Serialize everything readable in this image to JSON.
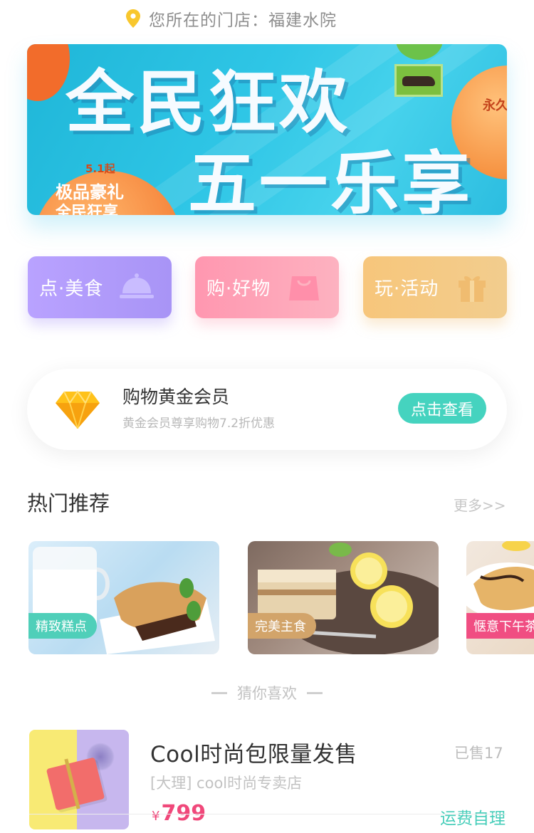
{
  "store": {
    "label": "您所在的门店：福建水院",
    "pin_icon": "location-pin-icon",
    "pin_color": "#f8c72d"
  },
  "banner": {
    "headline_line1": "全民狂欢",
    "headline_line2": "五一乐享",
    "date_tag": "5.1起",
    "gift_line1": "极品豪礼",
    "gift_line2": "全民狂享",
    "side_text": "永久"
  },
  "categories": [
    {
      "label": "点·美食",
      "icon": "food-cloche-icon",
      "color": "#b19cfb"
    },
    {
      "label": "购·好物",
      "icon": "shopping-bag-icon",
      "color": "#fda3b8"
    },
    {
      "label": "玩·活动",
      "icon": "gift-box-icon",
      "color": "#f4c985"
    }
  ],
  "member": {
    "title": "购物黄金会员",
    "desc": "黄金会员尊享购物7.2折优惠",
    "button": "点击查看",
    "icon": "diamond-icon",
    "button_color": "#45d3bf"
  },
  "hot": {
    "title": "热门推荐",
    "more": "更多>>",
    "items": [
      {
        "tag": "精致糕点"
      },
      {
        "tag": "完美主食"
      },
      {
        "tag": "惬意下午茶"
      }
    ]
  },
  "guess": {
    "title": "猜你喜欢"
  },
  "product": {
    "name": "Cool时尚包限量发售",
    "sold": "已售17",
    "store": "[大理] cool时尚专卖店",
    "currency": "¥",
    "price": "799",
    "shipping": "运费自理",
    "price_color": "#f0487a"
  }
}
